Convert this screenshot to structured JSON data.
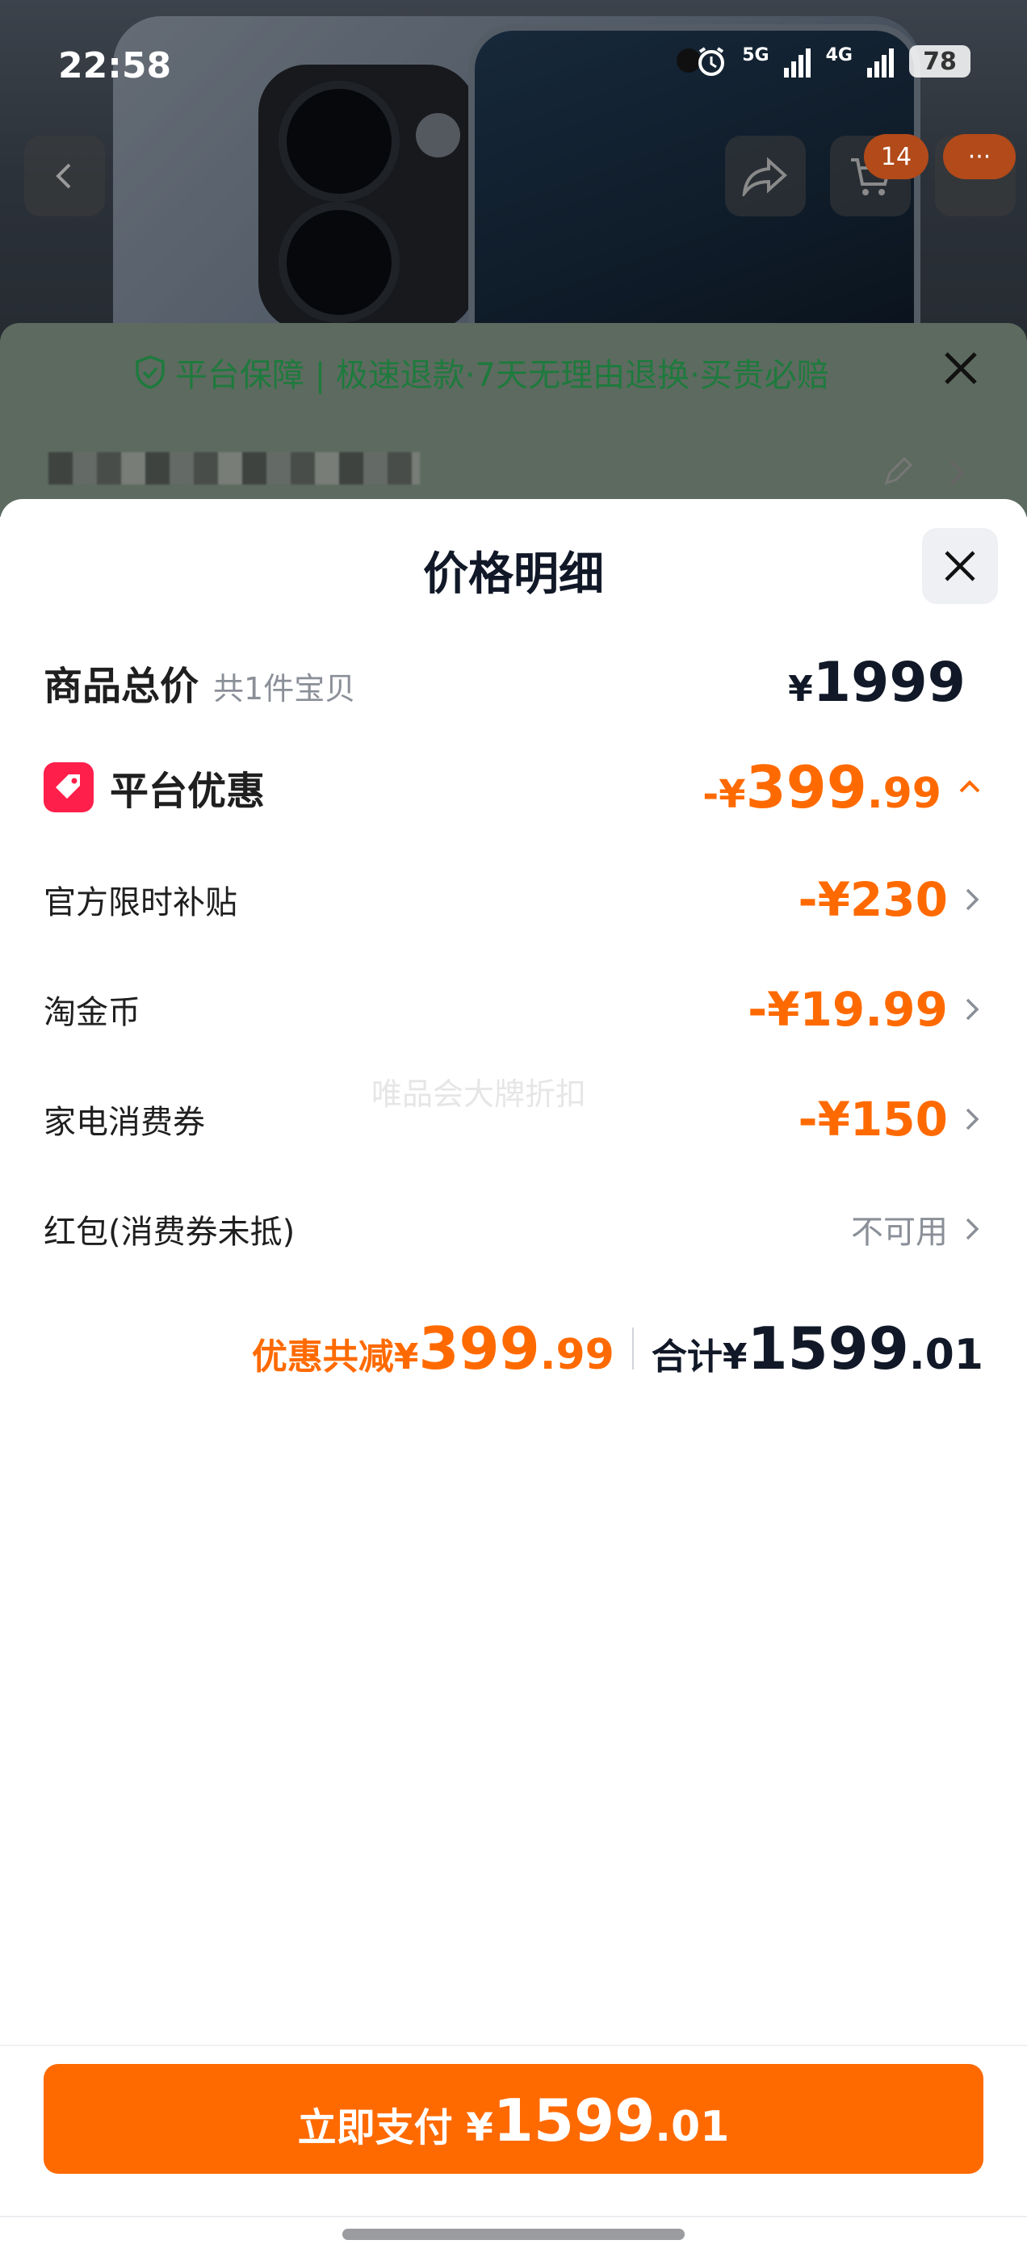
{
  "status_bar": {
    "time": "22:58",
    "network_1": "5G",
    "network_2": "4G",
    "battery": "78"
  },
  "nav": {
    "cart_badge": "14",
    "more_badge": "···"
  },
  "guarantee": {
    "text": "平台保障 | 极速退款·7天无理由退换·买贵必赔"
  },
  "sheet": {
    "title": "价格明细",
    "total_row": {
      "label": "商品总价",
      "sub": "共1件宝贝",
      "currency": "¥",
      "value": "1999"
    },
    "platform_discount": {
      "label": "平台优惠",
      "sign": "-¥",
      "int": "399",
      "dec": ".99"
    },
    "items": [
      {
        "label": "官方限时补贴",
        "value": "-¥230"
      },
      {
        "label": "淘金币",
        "value": "-¥19.99"
      },
      {
        "label": "家电消费券",
        "value": "-¥150"
      },
      {
        "label": "红包(消费券未抵)",
        "value": "不可用"
      }
    ],
    "watermark": "唯品会大牌折扣",
    "summary": {
      "discount_label": "优惠共减¥",
      "discount_int": "399",
      "discount_dec": ".99",
      "total_label": "合计¥",
      "total_int": "1599",
      "total_dec": ".01"
    },
    "pay_button": {
      "label": "立即支付 ¥",
      "int": "1599",
      "dec": ".01"
    }
  },
  "colors": {
    "accent": "#ff6a00",
    "tag": "#ff1f4b",
    "guarantee_green": "#1e7a3d"
  }
}
